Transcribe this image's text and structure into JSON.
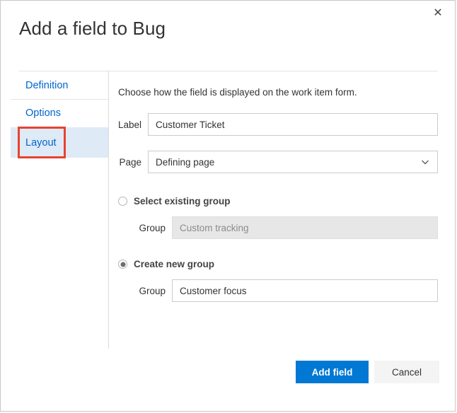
{
  "dialog": {
    "title": "Add a field to Bug",
    "close_icon": "close-icon",
    "close_glyph": "✕"
  },
  "sidebar": {
    "items": [
      {
        "label": "Definition",
        "selected": false
      },
      {
        "label": "Options",
        "selected": false
      },
      {
        "label": "Layout",
        "selected": true
      }
    ],
    "highlight_color": "#e8432f",
    "selected_bg": "#deeaf6",
    "link_color": "#0066cc"
  },
  "form": {
    "intro": "Choose how the field is displayed on the work item form.",
    "label_field": {
      "label": "Label",
      "value": "Customer Ticket",
      "placeholder": ""
    },
    "page_field": {
      "label": "Page",
      "value": "Defining page",
      "icon": "chevron-down-icon",
      "options": [
        "Defining page"
      ]
    },
    "existing_group": {
      "radio_label": "Select existing group",
      "checked": false,
      "group_label": "Group",
      "group_value": "Custom tracking",
      "disabled": true
    },
    "new_group": {
      "radio_label": "Create new group",
      "checked": true,
      "group_label": "Group",
      "group_value": "Customer focus",
      "disabled": false
    }
  },
  "footer": {
    "primary_label": "Add field",
    "secondary_label": "Cancel",
    "primary_color": "#0078d4",
    "secondary_color": "#f4f4f4"
  }
}
